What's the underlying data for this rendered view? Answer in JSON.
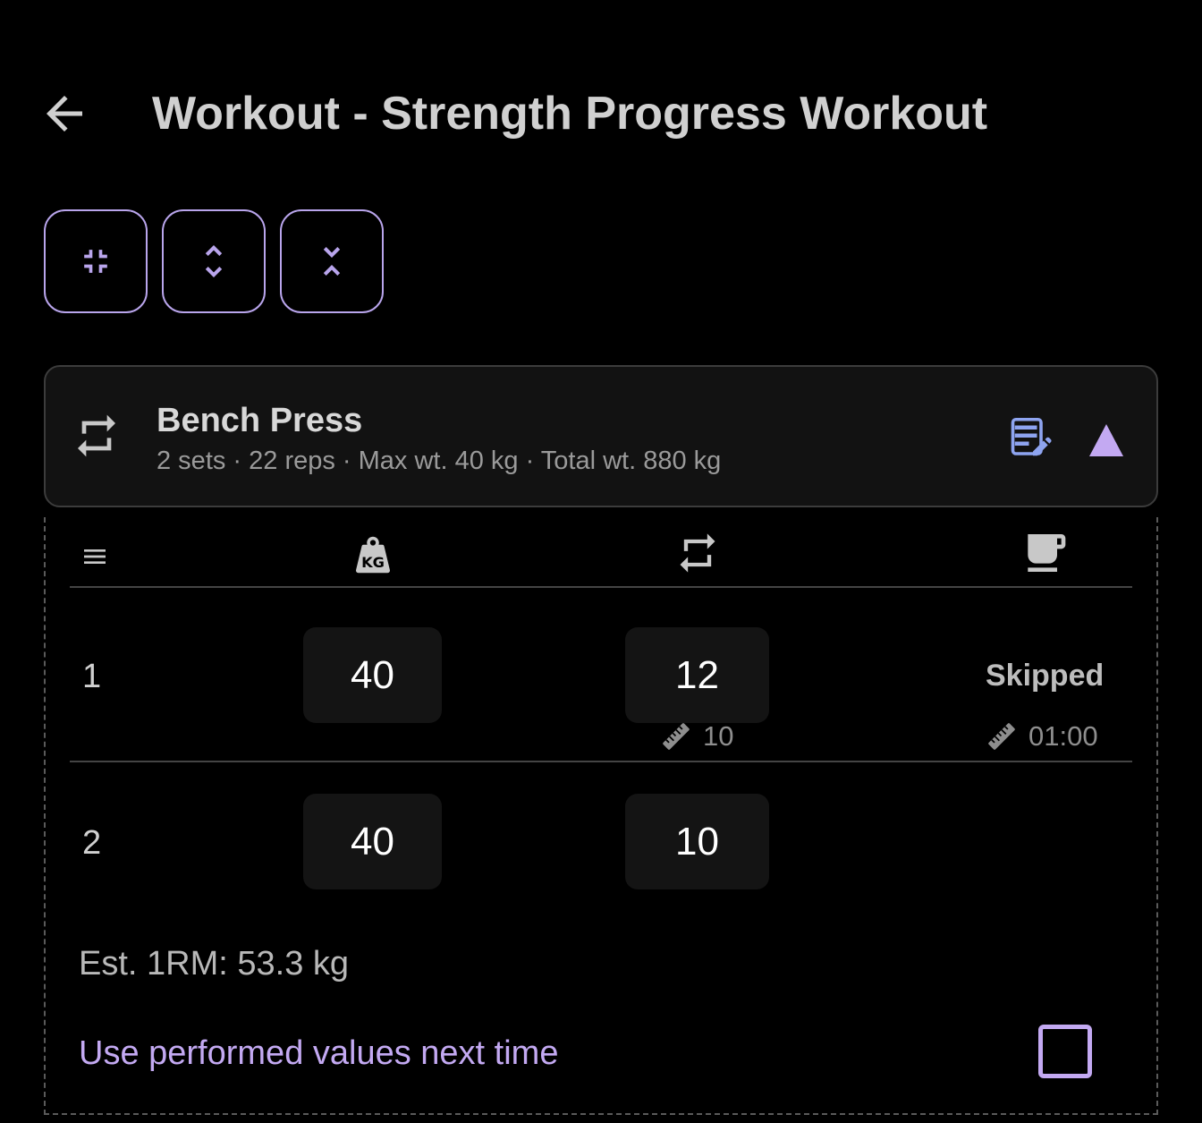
{
  "header": {
    "title": "Workout - Strength Progress Workout",
    "back_icon": "arrow-left-icon"
  },
  "toolbar": {
    "buttons": [
      {
        "icon": "collapse-all-icon"
      },
      {
        "icon": "unfold-more-icon"
      },
      {
        "icon": "unfold-less-icon"
      }
    ],
    "accent_color": "#b9a5ec"
  },
  "exercise": {
    "name": "Bench Press",
    "summary": "2 sets · 22 reps · Max wt. 40 kg · Total wt. 880 kg",
    "type_icon": "repeat-icon",
    "notes_icon": "edit-notes-icon",
    "collapse_icon": "triangle-up-icon"
  },
  "table": {
    "columns": [
      {
        "icon": "menu-lines-icon"
      },
      {
        "icon": "kettlebell-kg-icon"
      },
      {
        "icon": "repeat-icon"
      },
      {
        "icon": "coffee-cup-icon"
      }
    ],
    "sets": [
      {
        "number": "1",
        "weight": "40",
        "reps": "12",
        "reps_target": "10",
        "rest_status": "Skipped",
        "rest_target": "01:00"
      },
      {
        "number": "2",
        "weight": "40",
        "reps": "10"
      }
    ]
  },
  "footer": {
    "est_1rm": "Est. 1RM: 53.3 kg",
    "use_performed_label": "Use performed values next time",
    "use_performed_checked": false
  },
  "colors": {
    "background": "#000000",
    "accent": "#c3a9f2",
    "card": "#121212",
    "input_bg": "#141414"
  }
}
